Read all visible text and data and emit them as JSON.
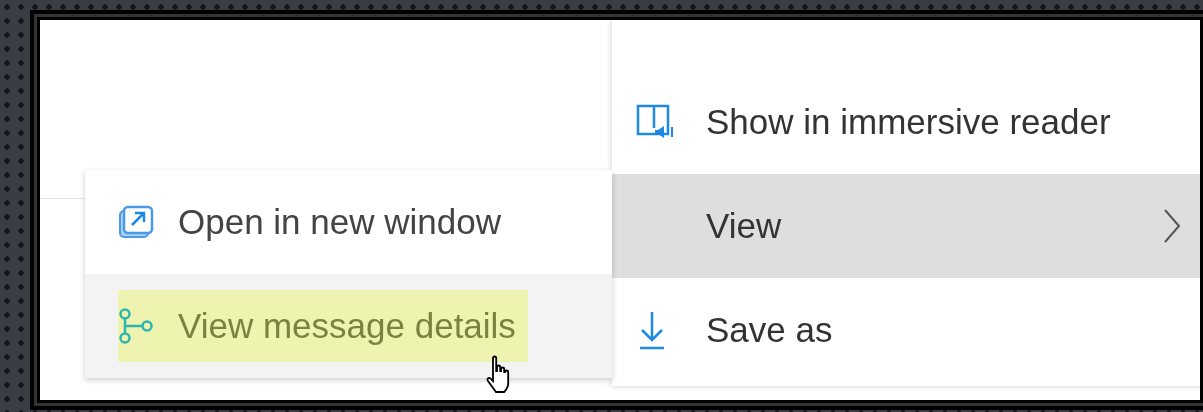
{
  "main_menu": {
    "items": [
      {
        "label": "Show in immersive reader",
        "selected": false,
        "has_submenu": false
      },
      {
        "label": "View",
        "selected": true,
        "has_submenu": true
      },
      {
        "label": "Save as",
        "selected": false,
        "has_submenu": false
      }
    ]
  },
  "submenu": {
    "items": [
      {
        "label": "Open in new window",
        "hovered": false,
        "highlighted": false
      },
      {
        "label": "View message details",
        "hovered": true,
        "highlighted": true
      }
    ]
  }
}
